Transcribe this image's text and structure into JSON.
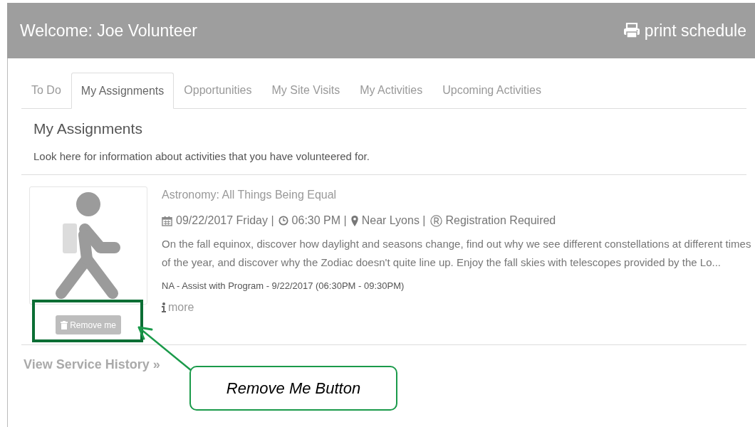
{
  "header": {
    "title": "Welcome: Joe Volunteer",
    "print_link": "print schedule"
  },
  "tabs": [
    {
      "label": "To Do",
      "selected": false
    },
    {
      "label": "My Assignments",
      "selected": true
    },
    {
      "label": "Opportunities",
      "selected": false
    },
    {
      "label": "My Site Visits",
      "selected": false
    },
    {
      "label": "My Activities",
      "selected": false
    },
    {
      "label": "Upcoming Activities",
      "selected": false
    }
  ],
  "section": {
    "title": "My Assignments",
    "description": "Look here for information about activities that you have volunteered for."
  },
  "assignment": {
    "title": "Astronomy: All Things Being Equal",
    "meta": [
      {
        "kind": "calendar",
        "text": "09/22/2017 Friday |"
      },
      {
        "kind": "clock",
        "text": "06:30 PM |"
      },
      {
        "kind": "pin",
        "text": "Near Lyons |"
      },
      {
        "kind": "registered",
        "text": "Registration Required"
      }
    ],
    "description": "On the fall equinox, discover how daylight and seasons change, find out why we see different constellations at different times of the year, and discover why the Zodiac doesn't quite line up. Enjoy the fall skies with telescopes provided by the Lo...",
    "shift": "NA - Assist with Program - 9/22/2017 (06:30PM - 09:30PM)",
    "more_link": "more",
    "remove_button": "Remove me"
  },
  "history_link": "View Service History »",
  "annotation": {
    "callout": "Remove Me Button"
  }
}
